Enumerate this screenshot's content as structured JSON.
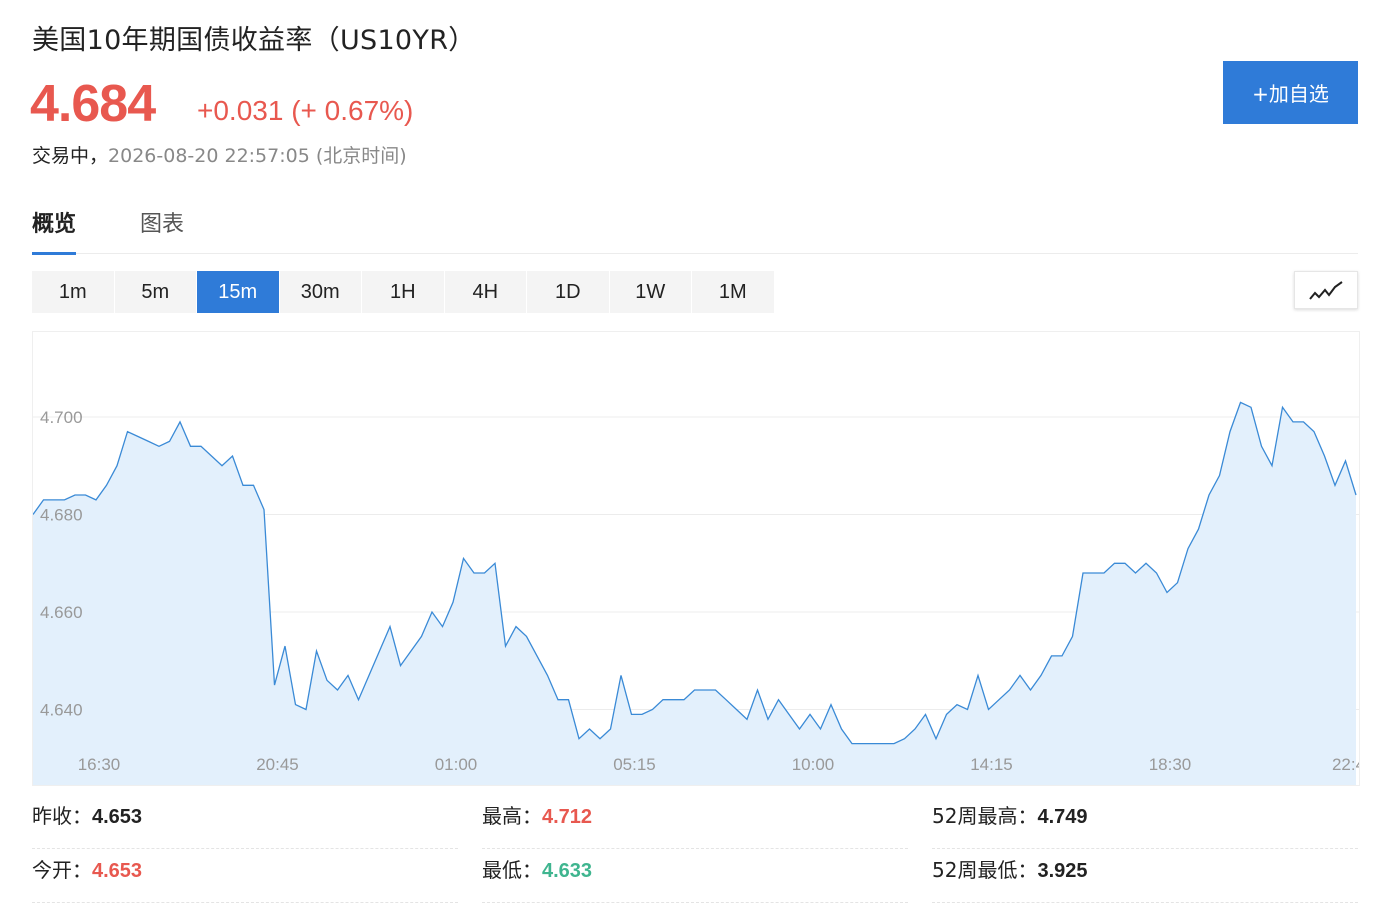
{
  "header": {
    "title": "美国10年期国债收益率（US10YR）",
    "price": "4.684",
    "change": "+0.031 (+ 0.67%)",
    "status": "交易中，",
    "timestamp": "2026-08-20 22:57:05 (北京时间)",
    "add_button": "+加自选"
  },
  "tabs": [
    {
      "label": "概览",
      "active": true
    },
    {
      "label": "图表",
      "active": false
    }
  ],
  "periods": [
    {
      "label": "1m",
      "active": false
    },
    {
      "label": "5m",
      "active": false
    },
    {
      "label": "15m",
      "active": true
    },
    {
      "label": "30m",
      "active": false
    },
    {
      "label": "1H",
      "active": false
    },
    {
      "label": "4H",
      "active": false
    },
    {
      "label": "1D",
      "active": false
    },
    {
      "label": "1W",
      "active": false
    },
    {
      "label": "1M",
      "active": false
    }
  ],
  "chart_type_icon": "line-chart-icon",
  "colors": {
    "accent": "#2f7bd8",
    "up": "#e8584f",
    "down": "#3fb58f",
    "line": "#3a8ad6",
    "fill": "#e3f0fc"
  },
  "chart_data": {
    "type": "area",
    "ylim": [
      4.627,
      4.717
    ],
    "yticks": [
      "4.700",
      "4.680",
      "4.660",
      "4.640"
    ],
    "xticks": [
      "16:30",
      "20:45",
      "01:00",
      "05:15",
      "10:00",
      "14:15",
      "18:30",
      "22:4"
    ],
    "grid": true,
    "values": [
      4.68,
      4.683,
      4.683,
      4.683,
      4.684,
      4.684,
      4.683,
      4.686,
      4.69,
      4.697,
      4.696,
      4.695,
      4.694,
      4.695,
      4.699,
      4.694,
      4.694,
      4.692,
      4.69,
      4.692,
      4.686,
      4.686,
      4.681,
      4.645,
      4.653,
      4.641,
      4.64,
      4.652,
      4.646,
      4.644,
      4.647,
      4.642,
      4.647,
      4.652,
      4.657,
      4.649,
      4.652,
      4.655,
      4.66,
      4.657,
      4.662,
      4.671,
      4.668,
      4.668,
      4.67,
      4.653,
      4.657,
      4.655,
      4.651,
      4.647,
      4.642,
      4.642,
      4.634,
      4.636,
      4.634,
      4.636,
      4.647,
      4.639,
      4.639,
      4.64,
      4.642,
      4.642,
      4.642,
      4.644,
      4.644,
      4.644,
      4.642,
      4.64,
      4.638,
      4.644,
      4.638,
      4.642,
      4.639,
      4.636,
      4.639,
      4.636,
      4.641,
      4.636,
      4.633,
      4.633,
      4.633,
      4.633,
      4.633,
      4.634,
      4.636,
      4.639,
      4.634,
      4.639,
      4.641,
      4.64,
      4.647,
      4.64,
      4.642,
      4.644,
      4.647,
      4.644,
      4.647,
      4.651,
      4.651,
      4.655,
      4.668,
      4.668,
      4.668,
      4.67,
      4.67,
      4.668,
      4.67,
      4.668,
      4.664,
      4.666,
      4.673,
      4.677,
      4.684,
      4.688,
      4.697,
      4.703,
      4.702,
      4.694,
      4.69,
      4.702,
      4.699,
      4.699,
      4.697,
      4.692,
      4.686,
      4.691,
      4.684
    ]
  },
  "stats": [
    {
      "label": "昨收：",
      "value": "4.653",
      "color": "dark"
    },
    {
      "label": "最高：",
      "value": "4.712",
      "color": "red"
    },
    {
      "label": "52周最高：",
      "value": "4.749",
      "color": "dark"
    },
    {
      "label": "今开：",
      "value": "4.653",
      "color": "red"
    },
    {
      "label": "最低：",
      "value": "4.633",
      "color": "green"
    },
    {
      "label": "52周最低：",
      "value": "3.925",
      "color": "dark"
    }
  ]
}
